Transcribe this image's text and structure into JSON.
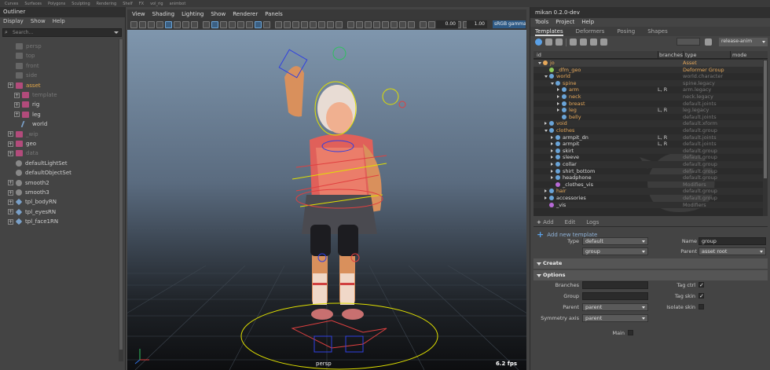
{
  "top_strip": [
    "Curves",
    "Surfaces",
    "Polygons",
    "Sculpting",
    "Rendering",
    "Shelf",
    "FX",
    "vol_rig",
    "animbot"
  ],
  "outliner": {
    "title": "Outliner",
    "menu": [
      "Display",
      "Show",
      "Help"
    ],
    "search_placeholder": "Search...",
    "items": [
      {
        "label": "persp",
        "icon": "camera-icon",
        "state": "dim"
      },
      {
        "label": "top",
        "icon": "camera-icon",
        "state": "dim"
      },
      {
        "label": "front",
        "icon": "camera-icon",
        "state": "dim"
      },
      {
        "label": "side",
        "icon": "camera-icon",
        "state": "dim"
      },
      {
        "label": "asset",
        "icon": "group-icon",
        "state": "sel"
      },
      {
        "label": "template",
        "icon": "group-icon",
        "state": "dim"
      },
      {
        "label": "rig",
        "icon": "group-icon",
        "state": "normal"
      },
      {
        "label": "leg",
        "icon": "group-icon",
        "state": "normal"
      },
      {
        "label": "world",
        "icon": "curve-icon",
        "state": "normal"
      },
      {
        "label": "_wip",
        "icon": "group-icon",
        "state": "dim"
      },
      {
        "label": "geo",
        "icon": "group-icon",
        "state": "normal"
      },
      {
        "label": "data",
        "icon": "group-icon",
        "state": "dim"
      },
      {
        "label": "defaultLightSet",
        "icon": "set-icon",
        "state": "normal"
      },
      {
        "label": "defaultObjectSet",
        "icon": "set-icon",
        "state": "normal"
      },
      {
        "label": "smooth2",
        "icon": "set-icon",
        "state": "normal"
      },
      {
        "label": "smooth3",
        "icon": "set-icon",
        "state": "normal"
      },
      {
        "label": "tpl_bodyRN",
        "icon": "reference-icon",
        "state": "normal"
      },
      {
        "label": "tpl_eyesRN",
        "icon": "reference-icon",
        "state": "normal"
      },
      {
        "label": "tpl_face1RN",
        "icon": "reference-icon",
        "state": "normal"
      }
    ]
  },
  "viewport": {
    "menu": [
      "View",
      "Shading",
      "Lighting",
      "Show",
      "Renderer",
      "Panels"
    ],
    "value_a": "0.00",
    "value_b": "1.00",
    "color_space": "sRGB gamma",
    "camera_label": "persp",
    "fps": "6.2 fps"
  },
  "mikan": {
    "title": "mikan 0.2.0-dev",
    "menu": [
      "Tools",
      "Project",
      "Help"
    ],
    "tabs": [
      "Templates",
      "Deformers",
      "Posing",
      "Shapes"
    ],
    "active_tab": "Templates",
    "preset": "release-anim",
    "tree_headers": {
      "id": "id",
      "branches": "branches",
      "type": "type",
      "mode": "mode"
    },
    "tree_rows": [
      {
        "name": "jo",
        "branches": "",
        "type": "Asset",
        "indent": 0,
        "arrow": "open",
        "icon": "#e6a85a",
        "type_color": "#e6a85a"
      },
      {
        "name": "_dfm_geo",
        "branches": "",
        "type": "Deformer Group",
        "indent": 1,
        "arrow": "",
        "icon": "#8fce5a",
        "type_color": "#e6a85a"
      },
      {
        "name": "world",
        "branches": "",
        "type": "world.character",
        "indent": 1,
        "arrow": "open",
        "icon": "#6aa4d8",
        "type_color": "#777"
      },
      {
        "name": "spine",
        "branches": "",
        "type": "spine.legacy",
        "indent": 2,
        "arrow": "open",
        "icon": "#6aa4d8",
        "type_color": "#777"
      },
      {
        "name": "arm",
        "branches": "L, R",
        "type": "arm.legacy",
        "indent": 3,
        "arrow": "closed",
        "icon": "#6aa4d8",
        "type_color": "#777"
      },
      {
        "name": "neck",
        "branches": "",
        "type": "neck.legacy",
        "indent": 3,
        "arrow": "closed",
        "icon": "#6aa4d8",
        "type_color": "#777"
      },
      {
        "name": "breast",
        "branches": "",
        "type": "default.joints",
        "indent": 3,
        "arrow": "closed",
        "icon": "#6aa4d8",
        "type_color": "#777"
      },
      {
        "name": "leg",
        "branches": "L, R",
        "type": "leg.legacy",
        "indent": 3,
        "arrow": "closed",
        "icon": "#6aa4d8",
        "type_color": "#777"
      },
      {
        "name": "belly",
        "branches": "",
        "type": "default.joints",
        "indent": 3,
        "arrow": "",
        "icon": "#6aa4d8",
        "type_color": "#777"
      },
      {
        "name": "void",
        "branches": "",
        "type": "default.xform",
        "indent": 1,
        "arrow": "closed",
        "icon": "#6aa4d8",
        "type_color": "#777"
      },
      {
        "name": "clothes",
        "branches": "",
        "type": "default.group",
        "indent": 1,
        "arrow": "open",
        "icon": "#6aa4d8",
        "type_color": "#777"
      },
      {
        "name": "armpit_dn",
        "branches": "L, R",
        "type": "default.joints",
        "indent": 2,
        "arrow": "closed",
        "icon": "#6aa4d8",
        "type_color": "#777",
        "white": true
      },
      {
        "name": "armpit",
        "branches": "L, R",
        "type": "default.joints",
        "indent": 2,
        "arrow": "closed",
        "icon": "#6aa4d8",
        "type_color": "#777",
        "white": true
      },
      {
        "name": "skirt",
        "branches": "",
        "type": "default.group",
        "indent": 2,
        "arrow": "closed",
        "icon": "#6aa4d8",
        "type_color": "#777",
        "white": true
      },
      {
        "name": "sleeve",
        "branches": "",
        "type": "default.group",
        "indent": 2,
        "arrow": "closed",
        "icon": "#6aa4d8",
        "type_color": "#777",
        "white": true
      },
      {
        "name": "collar",
        "branches": "",
        "type": "default.group",
        "indent": 2,
        "arrow": "closed",
        "icon": "#6aa4d8",
        "type_color": "#777",
        "white": true
      },
      {
        "name": "shirt_bottom",
        "branches": "",
        "type": "default.group",
        "indent": 2,
        "arrow": "closed",
        "icon": "#6aa4d8",
        "type_color": "#777",
        "white": true
      },
      {
        "name": "headphone",
        "branches": "",
        "type": "default.group",
        "indent": 2,
        "arrow": "closed",
        "icon": "#6aa4d8",
        "type_color": "#777",
        "white": true
      },
      {
        "name": "_clothes_vis",
        "branches": "",
        "type": "Modifiers",
        "indent": 2,
        "arrow": "",
        "icon": "#b86ad8",
        "type_color": "#777",
        "white": true
      },
      {
        "name": "hair",
        "branches": "",
        "type": "default.group",
        "indent": 1,
        "arrow": "closed",
        "icon": "#6aa4d8",
        "type_color": "#777"
      },
      {
        "name": "accessories",
        "branches": "",
        "type": "default.group",
        "indent": 1,
        "arrow": "closed",
        "icon": "#6aa4d8",
        "type_color": "#777",
        "white": true
      },
      {
        "name": "_vis",
        "branches": "",
        "type": "Modifiers",
        "indent": 1,
        "arrow": "",
        "icon": "#b86ad8",
        "type_color": "#777",
        "white": true
      }
    ],
    "bottom_tabs": [
      "Add",
      "Edit",
      "Logs"
    ],
    "add_new_template": "Add new template",
    "form": {
      "type_label": "Type",
      "type_value": "default",
      "subtype_value": "group",
      "name_label": "Name",
      "name_value": "group",
      "parent_label": "Parent",
      "parent_value": "asset root"
    },
    "create_section": "Create",
    "options_section": "Options",
    "options": {
      "branches_label": "Branches",
      "branches_value": "",
      "group_label": "Group",
      "group_value": "",
      "parent_label": "Parent",
      "parent_value": "parent",
      "symmetry_label": "Symmetry axis",
      "symmetry_value": "parent",
      "tag_ctrl_label": "Tag ctrl",
      "tag_ctrl_checked": true,
      "tag_skin_label": "Tag skin",
      "tag_skin_checked": true,
      "isolate_skin_label": "Isolate skin",
      "isolate_skin_checked": false,
      "main_label": "Main",
      "main_checked": false
    }
  }
}
